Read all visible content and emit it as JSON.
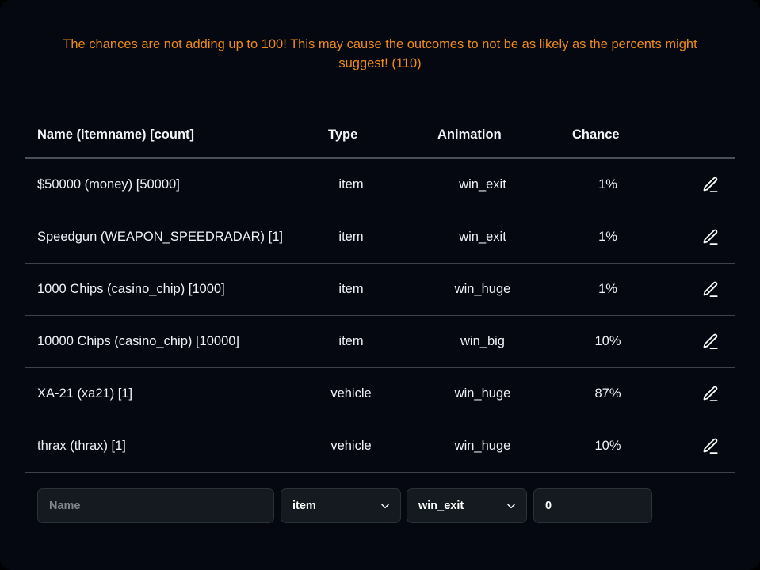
{
  "warning": {
    "text": "The chances are not adding up to 100! This may cause the outcomes to not be as likely as the percents might suggest! (110)",
    "color": "#ED8B16",
    "total": "110"
  },
  "table": {
    "columns": {
      "name": "Name (itemname) [count]",
      "type": "Type",
      "animation": "Animation",
      "chance": "Chance"
    },
    "rows": [
      {
        "name": "$50000 (money) [50000]",
        "type": "item",
        "animation": "win_exit",
        "chance": "1%",
        "edit_icon": "pencil-icon"
      },
      {
        "name": "Speedgun (WEAPON_SPEEDRADAR) [1]",
        "type": "item",
        "animation": "win_exit",
        "chance": "1%",
        "edit_icon": "pencil-icon"
      },
      {
        "name": "1000 Chips (casino_chip) [1000]",
        "type": "item",
        "animation": "win_huge",
        "chance": "1%",
        "edit_icon": "pencil-icon"
      },
      {
        "name": "10000 Chips (casino_chip) [10000]",
        "type": "item",
        "animation": "win_big",
        "chance": "10%",
        "edit_icon": "pencil-icon"
      },
      {
        "name": "XA-21 (xa21) [1]",
        "type": "vehicle",
        "animation": "win_huge",
        "chance": "87%",
        "edit_icon": "pencil-icon"
      },
      {
        "name": "thrax (thrax) [1]",
        "type": "vehicle",
        "animation": "win_huge",
        "chance": "10%",
        "edit_icon": "pencil-icon"
      }
    ]
  },
  "add_form": {
    "name_placeholder": "Name",
    "name_value": "",
    "type_value": "item",
    "animation_value": "win_exit",
    "chance_value": "0",
    "chevron_icon": "chevron-down-icon"
  }
}
